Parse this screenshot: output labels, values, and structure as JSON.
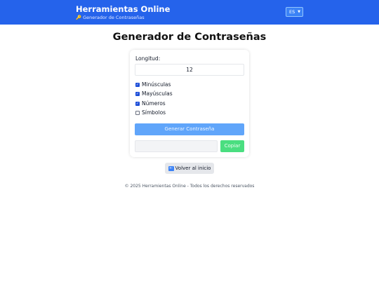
{
  "header": {
    "title": "Herramientas Online",
    "subtitle": "Generador de Contraseñas",
    "subtitle_icon": "key-icon",
    "language": "ES",
    "colors": {
      "bar": "#2563eb"
    }
  },
  "main": {
    "title": "Generador de Contraseñas",
    "length_label": "Longitud:",
    "length_value": "12",
    "options": [
      {
        "label": "Minúsculas",
        "checked": true
      },
      {
        "label": "Mayúsculas",
        "checked": true
      },
      {
        "label": "Números",
        "checked": true
      },
      {
        "label": "Símbolos",
        "checked": false
      }
    ],
    "generate_label": "Generar Contraseña",
    "password_value": "",
    "copy_label": "Copiar",
    "colors": {
      "generate": "#60a5fa",
      "copy": "#4ade80"
    }
  },
  "back": {
    "label": "Volver al inicio",
    "icon": "back-arrow-icon"
  },
  "footer": {
    "text": "© 2025 Herramientas Online - Todos los derechos reservados"
  }
}
